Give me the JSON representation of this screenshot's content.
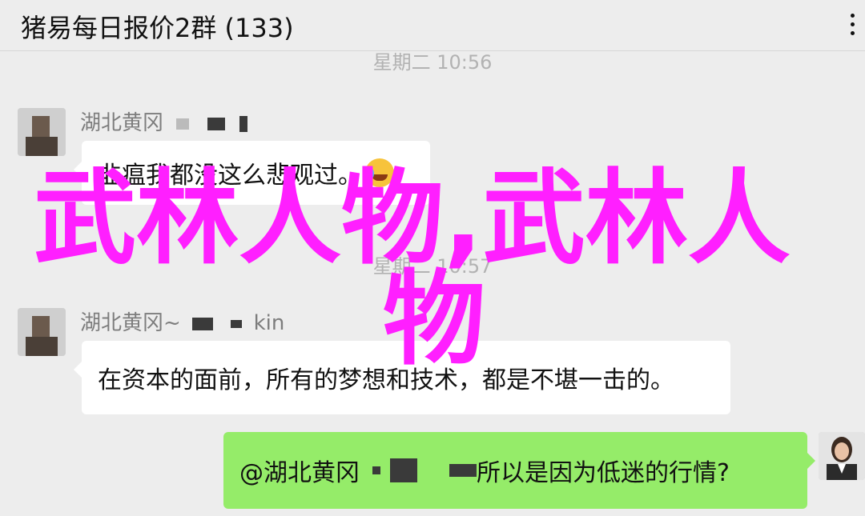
{
  "header": {
    "title": "猪易每日报价2群 (133)"
  },
  "messages": {
    "time1": "星期二 10:56",
    "time2": "星期二 10:57",
    "m1": {
      "sender": "湖北黄冈",
      "text": "韭瘟我都没这么悲观过。"
    },
    "m2": {
      "sender": "湖北黄冈~",
      "sender_tail": "kin",
      "text": "在资本的面前，所有的梦想和技术，都是不堪一击的。"
    },
    "m3": {
      "mention": "@湖北黄冈",
      "text": "所以是因为低迷的行情?"
    }
  },
  "overlay": {
    "line1": "武林人物,武林人",
    "line2": "物"
  },
  "colors": {
    "overlay": "#ff1fff",
    "bubble_self": "#95ec69",
    "bubble_other": "#ffffff",
    "background": "#ededed"
  },
  "icons": {
    "more": "more-vertical-icon",
    "emoji": "face-with-tears-of-joy-emoji"
  }
}
